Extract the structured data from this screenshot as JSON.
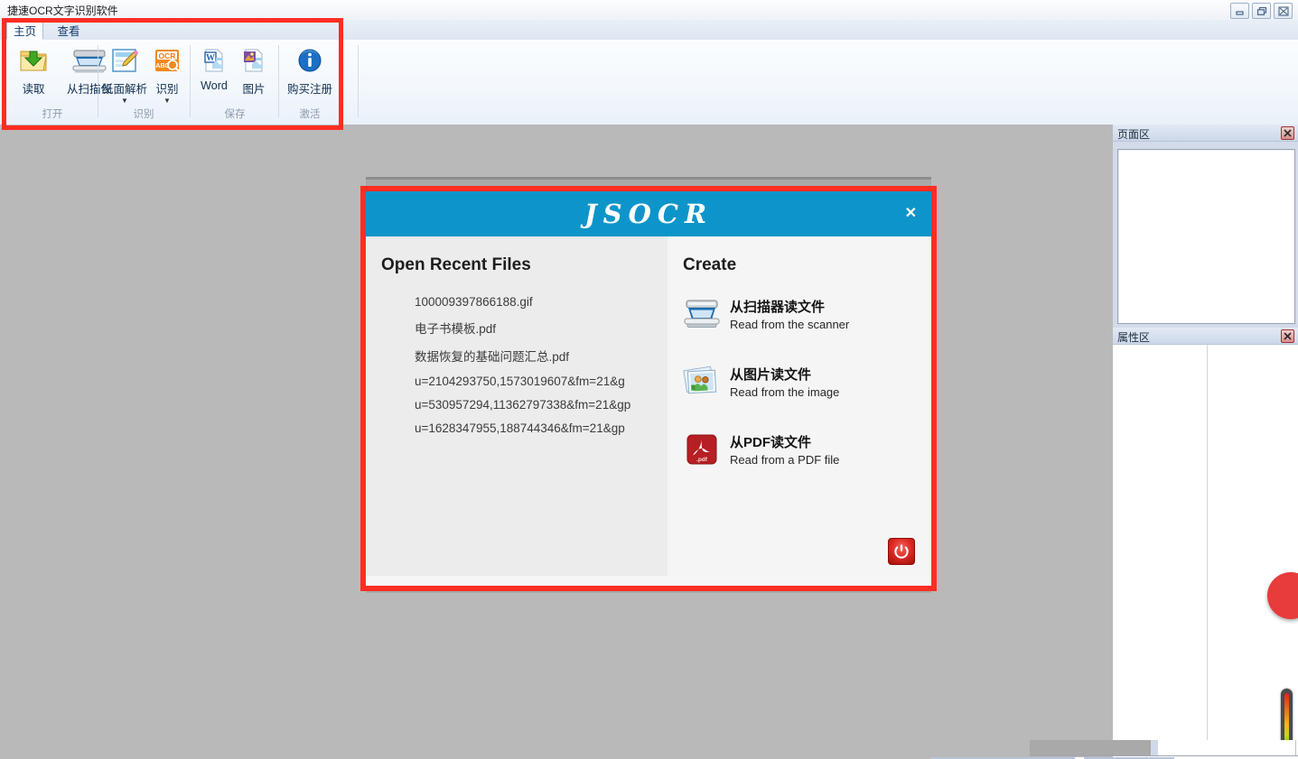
{
  "window": {
    "title": "捷速OCR文字识别软件",
    "controls": [
      {
        "name": "minimize-button",
        "glyph": "minimize"
      },
      {
        "name": "restore-button",
        "glyph": "restore"
      },
      {
        "name": "close-button",
        "glyph": "close"
      }
    ]
  },
  "ribbon": {
    "tabs": [
      {
        "label": "主页",
        "active": true
      },
      {
        "label": "查看",
        "active": false
      }
    ],
    "groups": [
      {
        "label": "打开",
        "items": [
          {
            "label": "读取",
            "icon": "open-folder-icon",
            "caret": false
          },
          {
            "label": "从扫描仪",
            "icon": "scanner-icon",
            "caret": false
          }
        ]
      },
      {
        "label": "识别",
        "items": [
          {
            "label": "纸面解析",
            "icon": "page-analysis-icon",
            "caret": true
          },
          {
            "label": "识别",
            "icon": "ocr-icon",
            "caret": true
          }
        ]
      },
      {
        "label": "保存",
        "items": [
          {
            "label": "Word",
            "icon": "word-doc-icon",
            "caret": false
          },
          {
            "label": "图片",
            "icon": "image-doc-icon",
            "caret": false
          }
        ]
      },
      {
        "label": "激活",
        "items": [
          {
            "label": "购买注册",
            "icon": "info-icon",
            "caret": false
          }
        ]
      }
    ],
    "highlight_color": "#ff2d23"
  },
  "panels": {
    "page_area": {
      "title": "页面区",
      "close_icon": "close-icon"
    },
    "property_area": {
      "title": "属性区",
      "close_icon": "close-icon"
    }
  },
  "dialog": {
    "logo": "JSOCR",
    "close_label": "✕",
    "border_color": "#ff2d23",
    "title_bg": "#0d95c9",
    "left": {
      "title": "Open Recent Files",
      "files": [
        "100009397866188.gif",
        "电子书模板.pdf",
        "数据恢复的基础问题汇总.pdf",
        "u=2104293750,1573019607&fm=21&g",
        "u=530957294,11362797338&fm=21&gp",
        "u=1628347955,188744346&fm=21&gp"
      ]
    },
    "right": {
      "title": "Create",
      "items": [
        {
          "icon": "scanner-icon",
          "title_cn": "从扫描器读文件",
          "title_en": "Read from the scanner"
        },
        {
          "icon": "photos-icon",
          "title_cn": "从图片读文件",
          "title_en": "Read from the image"
        },
        {
          "icon": "pdf-icon",
          "title_cn": "从PDF读文件",
          "title_en": "Read from a PDF file"
        }
      ]
    },
    "power_button": {
      "name": "exit-power-button",
      "icon": "power-icon",
      "color": "#df2b24"
    }
  },
  "gauge": {
    "name": "color-gauge",
    "colors": [
      "#ee1b1b",
      "#f5b711",
      "#23d424"
    ]
  }
}
